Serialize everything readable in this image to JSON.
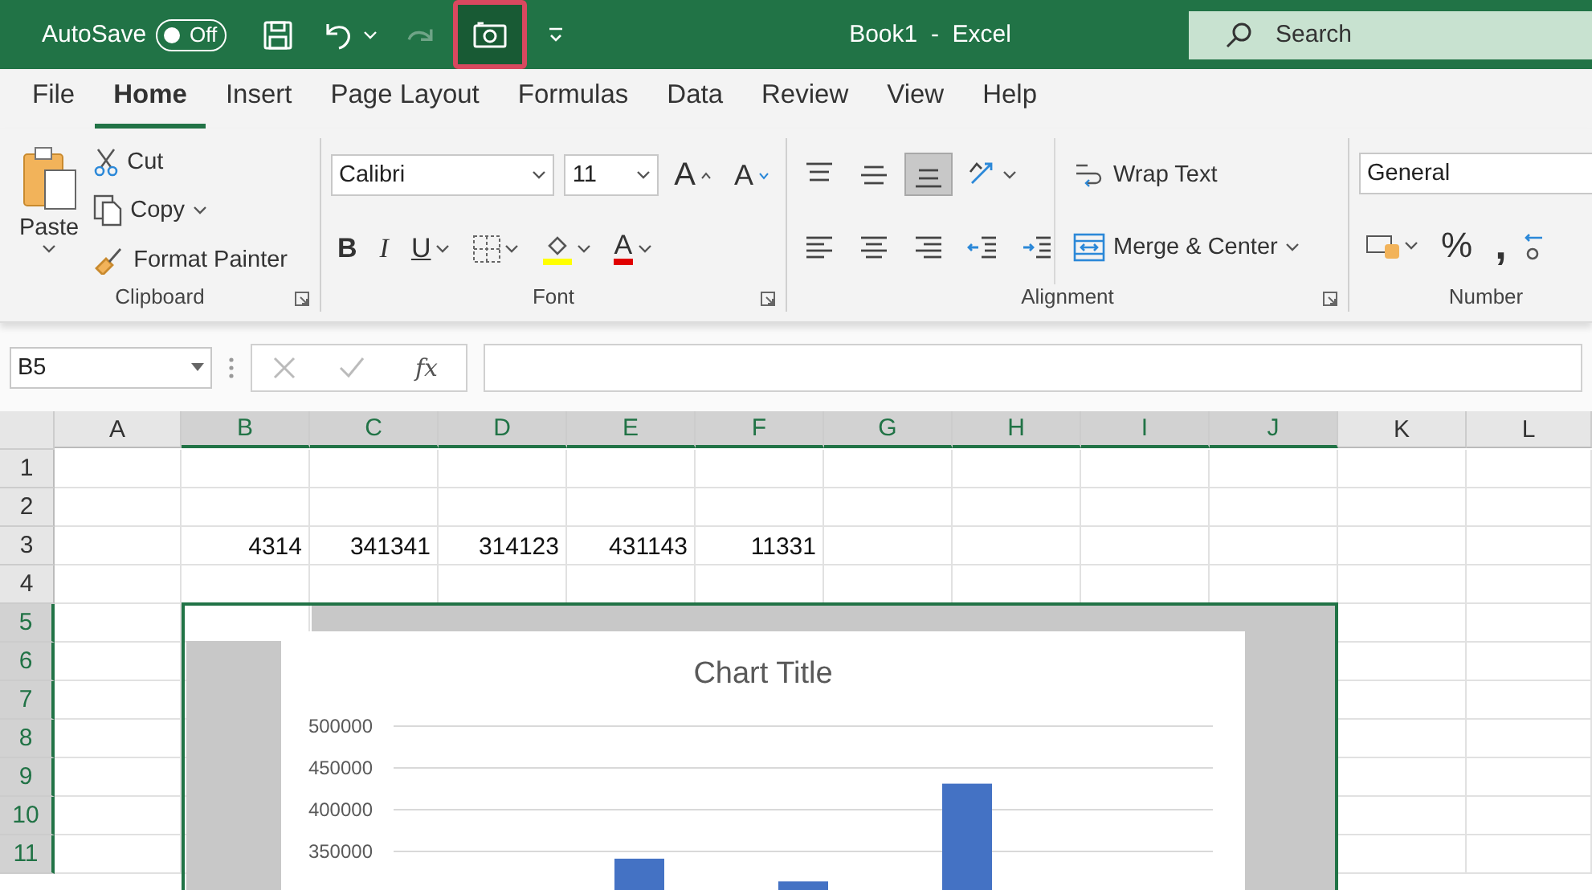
{
  "title_bar": {
    "autosave": {
      "label": "AutoSave",
      "on": false,
      "state_text": "Off"
    },
    "quick_access": [
      {
        "kind": "save",
        "disabled": false,
        "highlighted": false
      },
      {
        "kind": "undo",
        "disabled": false,
        "highlighted": false
      },
      {
        "kind": "redo",
        "disabled": true,
        "highlighted": false
      },
      {
        "kind": "camera",
        "disabled": false,
        "highlighted": true
      },
      {
        "kind": "customize",
        "disabled": false,
        "highlighted": false
      }
    ],
    "title": "Book1  -  Excel",
    "search": {
      "placeholder": "Search"
    }
  },
  "tabs": [
    {
      "label": "File",
      "selected": false
    },
    {
      "label": "Home",
      "selected": true
    },
    {
      "label": "Insert",
      "selected": false
    },
    {
      "label": "Page Layout",
      "selected": false
    },
    {
      "label": "Formulas",
      "selected": false
    },
    {
      "label": "Data",
      "selected": false
    },
    {
      "label": "Review",
      "selected": false
    },
    {
      "label": "View",
      "selected": false
    },
    {
      "label": "Help",
      "selected": false
    }
  ],
  "ribbon": {
    "clipboard": {
      "label": "Clipboard",
      "paste": "Paste",
      "cut": "Cut",
      "copy": "Copy",
      "format_painter": "Format Painter"
    },
    "font": {
      "label": "Font",
      "font_name": "Calibri",
      "font_size": "11",
      "grow": "A",
      "shrink": "A",
      "bold": "B",
      "italic": "I",
      "underline": "U",
      "font_color": "A"
    },
    "alignment": {
      "label": "Alignment",
      "buttons": [
        {
          "kind": "align-top",
          "selected": false
        },
        {
          "kind": "align-middle",
          "selected": false
        },
        {
          "kind": "align-bottom",
          "selected": true
        },
        {
          "kind": "orientation",
          "selected": false
        },
        {
          "kind": "align-left",
          "selected": false
        },
        {
          "kind": "align-center",
          "selected": false
        },
        {
          "kind": "align-right",
          "selected": false
        },
        {
          "kind": "decrease-indent",
          "selected": false
        },
        {
          "kind": "increase-indent",
          "selected": false
        }
      ],
      "wrap_text": "Wrap Text",
      "merge_center": "Merge & Center"
    },
    "number": {
      "label": "Number",
      "format": "General",
      "percent": "%",
      "comma": ","
    }
  },
  "formula_bar": {
    "name_box": "B5",
    "fx": "fx"
  },
  "grid": {
    "columns": [
      {
        "label": "A",
        "selected": false
      },
      {
        "label": "B",
        "selected": true
      },
      {
        "label": "C",
        "selected": true
      },
      {
        "label": "D",
        "selected": true
      },
      {
        "label": "E",
        "selected": true
      },
      {
        "label": "F",
        "selected": true
      },
      {
        "label": "G",
        "selected": true
      },
      {
        "label": "H",
        "selected": true
      },
      {
        "label": "I",
        "selected": true
      },
      {
        "label": "J",
        "selected": true
      },
      {
        "label": "K",
        "selected": false
      },
      {
        "label": "L",
        "selected": false
      }
    ],
    "rows": [
      {
        "label": "1",
        "selected": false,
        "cells": {}
      },
      {
        "label": "2",
        "selected": false,
        "cells": {}
      },
      {
        "label": "3",
        "selected": false,
        "cells": {
          "B": "4314",
          "C": "341341",
          "D": "314123",
          "E": "431143",
          "F": "11331"
        }
      },
      {
        "label": "4",
        "selected": false,
        "cells": {}
      },
      {
        "label": "5",
        "selected": true,
        "cells": {}
      },
      {
        "label": "6",
        "selected": true,
        "cells": {}
      },
      {
        "label": "7",
        "selected": true,
        "cells": {}
      },
      {
        "label": "8",
        "selected": true,
        "cells": {}
      },
      {
        "label": "9",
        "selected": true,
        "cells": {}
      },
      {
        "label": "10",
        "selected": true,
        "cells": {}
      },
      {
        "label": "11",
        "selected": true,
        "cells": {}
      }
    ],
    "linked_picture": {
      "chart_data": {
        "type": "bar",
        "title": "Chart Title",
        "series": [
          {
            "color": "#4472c4",
            "values": [
              null,
              341341,
              314123,
              431143,
              null
            ]
          }
        ],
        "grid": true,
        "ylim": [
          0,
          500000
        ],
        "yticks": [
          350000,
          400000,
          450000,
          500000
        ]
      }
    }
  }
}
